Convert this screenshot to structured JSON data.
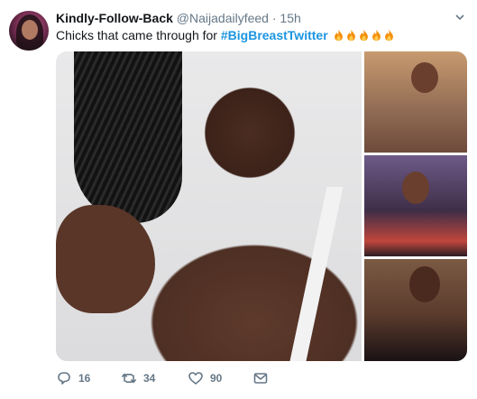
{
  "tweet": {
    "display_name": "Kindly-Follow-Back",
    "handle": "@Naijadailyfeed",
    "separator": "·",
    "time": "15h",
    "text_prefix": "Chicks that came through for ",
    "hashtag": "#BigBreastTwitter",
    "emoji_count": 5,
    "emoji_name": "fire-icon"
  },
  "actions": {
    "replies": "16",
    "retweets": "34",
    "likes": "90"
  },
  "icons": {
    "reply": "reply-icon",
    "retweet": "retweet-icon",
    "like": "heart-icon",
    "dm": "envelope-icon",
    "caret": "chevron-down-icon"
  },
  "colors": {
    "link": "#1b95e0",
    "muted": "#657786",
    "text": "#14171a"
  }
}
